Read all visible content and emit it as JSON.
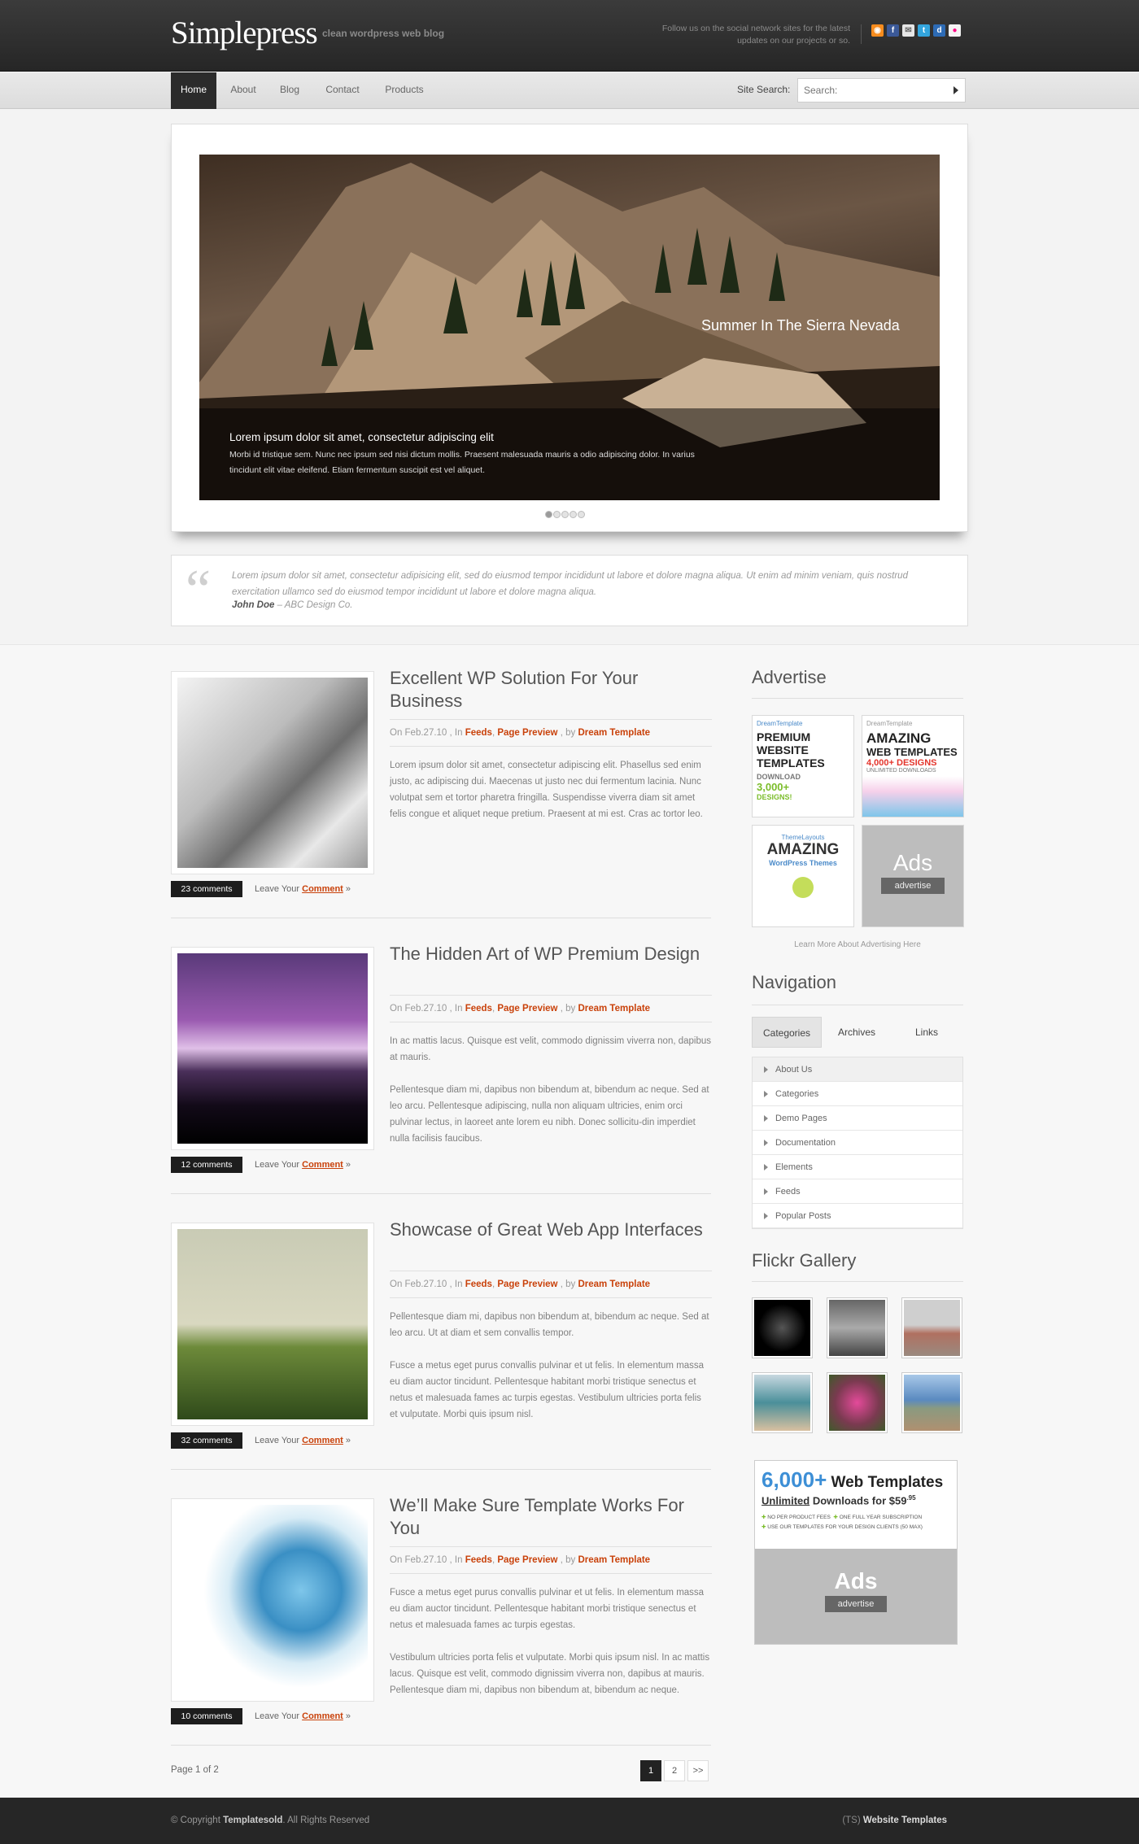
{
  "header": {
    "logo": "Simplepress",
    "tagline": "clean wordpress web blog",
    "follow_line1": "Follow us on the social network sites for the latest",
    "follow_line2": "updates on our projects or so."
  },
  "social_icons": [
    "rss-icon",
    "facebook-icon",
    "email-icon",
    "twitter-icon",
    "delicious-icon",
    "flickr-icon"
  ],
  "nav": {
    "items": [
      "Home",
      "About",
      "Blog",
      "Contact",
      "Products"
    ],
    "search_label": "Site Search:",
    "search_placeholder": "Search:"
  },
  "slider": {
    "caption": "Summer In The Sierra Nevada",
    "title": "Lorem ipsum dolor sit amet, consectetur adipiscing elit",
    "text": "Morbi id tristique sem. Nunc nec ipsum sed nisi dictum mollis. Praesent malesuada mauris a odio adipiscing dolor. In varius tincidunt elit vitae eleifend. Etiam fermentum suscipit est vel aliquet.",
    "dots": 5,
    "active_dot": 1
  },
  "quote": {
    "text": "Lorem ipsum dolor sit amet, consectetur adipisicing elit, sed do eiusmod tempor incididunt ut labore et dolore magna aliqua. Ut enim ad minim veniam, quis nostrud exercitation ullamco sed do eiusmod tempor incididunt ut labore et dolore magna aliqua.",
    "author": "John Doe",
    "company": "– ABC Design Co."
  },
  "meta": {
    "on": "On Feb.27.10 , In ",
    "cat1": "Feeds",
    "sep": ", ",
    "cat2": "Page Preview",
    "by": " , by ",
    "author": "Dream Template",
    "leave": "Leave Your ",
    "comment": "Comment",
    "arrow": " »"
  },
  "posts": [
    {
      "title": "Excellent WP Solution For Your Business",
      "paras": [
        "Lorem ipsum dolor sit amet, consectetur adipiscing elit. Phasellus sed enim justo, ac adipiscing dui. Maecenas ut justo nec dui fermentum lacinia. Nunc volutpat sem et tortor pharetra fringilla. Suspendisse viverra diam sit amet felis congue et aliquet neque pretium. Praesent at mi est. Cras ac tortor leo."
      ],
      "comments": "23 comments"
    },
    {
      "title": "The Hidden Art of WP Premium Design",
      "paras": [
        "In ac mattis lacus. Quisque est velit, commodo dignissim viverra non, dapibus at mauris.",
        "Pellentesque diam mi, dapibus non bibendum at, bibendum ac neque. Sed at leo arcu. Pellentesque adipiscing, nulla non aliquam ultricies, enim orci pulvinar lectus, in laoreet ante lorem eu nibh. Donec sollicitu-din imperdiet nulla facilisis faucibus."
      ],
      "comments": "12 comments"
    },
    {
      "title": "Showcase of Great Web App Interfaces",
      "paras": [
        "Pellentesque diam mi, dapibus non bibendum at, bibendum ac neque. Sed at leo arcu. Ut at diam et sem convallis tempor.",
        "Fusce a metus eget purus convallis pulvinar et ut felis. In elementum massa eu diam auctor tincidunt. Pellentesque habitant morbi tristique senectus et netus et malesuada fames ac turpis egestas. Vestibulum ultricies porta felis et vulputate. Morbi quis ipsum nisl."
      ],
      "comments": "32 comments"
    },
    {
      "title": "We’ll Make Sure Template Works For You",
      "paras": [
        "Fusce a metus eget purus convallis pulvinar et ut felis. In elementum massa eu diam auctor tincidunt. Pellentesque habitant morbi tristique senectus et netus et malesuada fames ac turpis egestas.",
        "Vestibulum ultricies porta felis et vulputate. Morbi quis ipsum nisl. In ac mattis lacus. Quisque est velit, commodo dignissim viverra non, dapibus at mauris. Pellentesque diam mi, dapibus non bibendum at, bibendum ac neque."
      ],
      "comments": "10 comments"
    }
  ],
  "pagination": {
    "label": "Page 1 of 2",
    "pages": [
      "1",
      "2",
      ">>"
    ]
  },
  "sidebar": {
    "advertise_title": "Advertise",
    "ads": [
      {
        "brand": "DreamTemplate",
        "l1": "PREMIUM",
        "l2": "WEBSITE",
        "l3": "TEMPLATES",
        "l4": "DOWNLOAD",
        "l5": "3,000+",
        "l6": "DESIGNS!"
      },
      {
        "brand": "DreamTemplate",
        "l1": "AMAZING",
        "l2": "WEB TEMPLATES",
        "l3": "4,000+ DESIGNS",
        "l4": "UNLIMITED DOWNLOADS"
      },
      {
        "brand": "ThemeLayouts",
        "l1": "AMAZING",
        "l2": "WordPress Themes"
      },
      {
        "l1": "Ads",
        "l2": "advertise"
      }
    ],
    "advertise_link": "Learn More About Advertising Here",
    "navigation_title": "Navigation",
    "tabs": [
      "Categories",
      "Archives",
      "Links"
    ],
    "categories": [
      "About Us",
      "Categories",
      "Demo Pages",
      "Documentation",
      "Elements",
      "Feeds",
      "Popular Posts"
    ],
    "flickr_title": "Flickr Gallery",
    "banner": {
      "big": "6,000+",
      "rest": " Web Templates",
      "l2a": "Unlimited",
      "l2b": " Downloads for $59",
      "cents": ".95",
      "b1": "NO PER PRODUCT FEES",
      "b2": "ONE FULL YEAR SUBSCRIPTION",
      "b3": "USE OUR TEMPLATES FOR YOUR DESIGN CLIENTS (50 MAX)",
      "ads": "Ads",
      "advertise": "advertise"
    }
  },
  "footer": {
    "copy_a": "© Copyright ",
    "copy_b": "Templatesold",
    "copy_c": ". All Rights Reserved",
    "ts_a": "(TS) ",
    "ts_b": "Website Templates"
  }
}
